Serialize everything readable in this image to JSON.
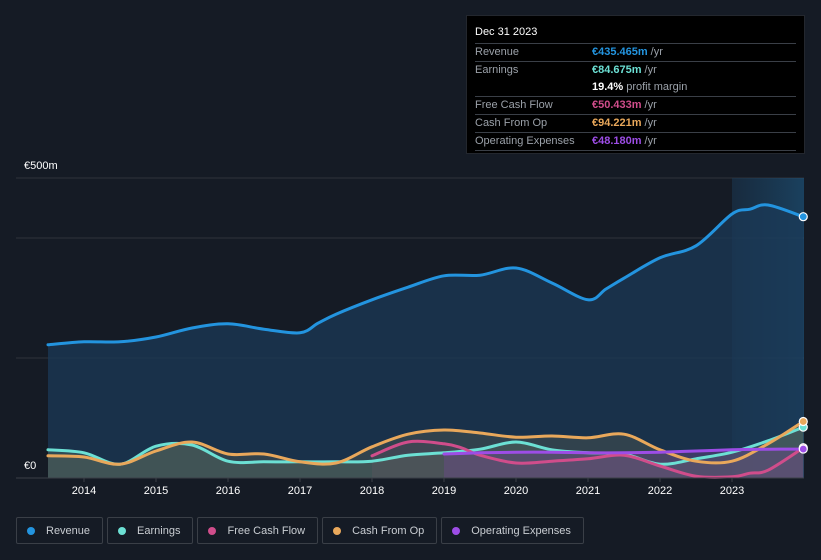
{
  "tooltip": {
    "date": "Dec 31 2023",
    "rows": [
      {
        "label": "Revenue",
        "value": "€435.465m",
        "unit": "/yr",
        "color": "#2394df"
      },
      {
        "label": "Earnings",
        "value": "€84.675m",
        "unit": "/yr",
        "color": "#6ce0d4"
      },
      {
        "label": "",
        "value": "19.4%",
        "unit": "profit margin",
        "color": "#ffffff"
      },
      {
        "label": "Free Cash Flow",
        "value": "€50.433m",
        "unit": "/yr",
        "color": "#d04d8b"
      },
      {
        "label": "Cash From Op",
        "value": "€94.221m",
        "unit": "/yr",
        "color": "#e9a85b"
      },
      {
        "label": "Operating Expenses",
        "value": "€48.180m",
        "unit": "/yr",
        "color": "#9d4de6"
      }
    ]
  },
  "legend": [
    {
      "label": "Revenue",
      "color": "#2394df"
    },
    {
      "label": "Earnings",
      "color": "#6ce0d4"
    },
    {
      "label": "Free Cash Flow",
      "color": "#d04d8b"
    },
    {
      "label": "Cash From Op",
      "color": "#e9a85b"
    },
    {
      "label": "Operating Expenses",
      "color": "#9d4de6"
    }
  ],
  "chart_data": {
    "type": "area",
    "title": "",
    "xlabel": "",
    "ylabel": "",
    "ylim": [
      0,
      500
    ],
    "xlim": [
      2013.5,
      2024.0
    ],
    "y_tick_labels": [
      "€0",
      "€500m"
    ],
    "y_gridlines": [
      200,
      400,
      500
    ],
    "x_tick_labels": [
      "2014",
      "2015",
      "2016",
      "2017",
      "2018",
      "2019",
      "2020",
      "2021",
      "2022",
      "2023"
    ],
    "x_ticks": [
      2014,
      2015,
      2016,
      2017,
      2018,
      2019,
      2020,
      2021,
      2022,
      2023
    ],
    "highlight_from": 2023.0,
    "legend_position": "bottom",
    "units": "€m",
    "series": [
      {
        "name": "Revenue",
        "color": "#2394df",
        "x": [
          2013.5,
          2014.0,
          2014.5,
          2015.0,
          2015.5,
          2016.0,
          2016.5,
          2017.0,
          2017.25,
          2017.5,
          2018.0,
          2018.5,
          2019.0,
          2019.5,
          2020.0,
          2020.5,
          2021.0,
          2021.25,
          2021.5,
          2022.0,
          2022.5,
          2023.0,
          2023.25,
          2023.5,
          2023.99
        ],
        "values": [
          222,
          227,
          227,
          235,
          250,
          257,
          248,
          242,
          258,
          273,
          297,
          318,
          337,
          338,
          350,
          325,
          297,
          315,
          333,
          367,
          387,
          440,
          448,
          455,
          435.5
        ]
      },
      {
        "name": "Earnings",
        "color": "#6ce0d4",
        "x": [
          2013.5,
          2014.0,
          2014.5,
          2015.0,
          2015.5,
          2016.0,
          2016.5,
          2017.0,
          2017.5,
          2018.0,
          2018.5,
          2019.0,
          2019.5,
          2020.0,
          2020.5,
          2021.0,
          2021.5,
          2022.0,
          2022.5,
          2023.0,
          2023.5,
          2023.99
        ],
        "values": [
          47,
          42,
          23,
          53,
          55,
          28,
          27,
          27,
          27,
          28,
          38,
          42,
          48,
          60,
          47,
          42,
          40,
          23,
          32,
          43,
          62,
          84.7
        ]
      },
      {
        "name": "Free Cash Flow",
        "color": "#d04d8b",
        "x": [
          2018.0,
          2018.5,
          2019.0,
          2019.25,
          2019.5,
          2020.0,
          2020.5,
          2021.0,
          2021.5,
          2022.0,
          2022.5,
          2023.0,
          2023.25,
          2023.5,
          2023.99
        ],
        "values": [
          37,
          60,
          57,
          50,
          38,
          25,
          28,
          32,
          38,
          20,
          3,
          2,
          8,
          13,
          50.4
        ]
      },
      {
        "name": "Cash From Op",
        "color": "#e9a85b",
        "x": [
          2013.5,
          2014.0,
          2014.5,
          2015.0,
          2015.5,
          2016.0,
          2016.5,
          2017.0,
          2017.5,
          2018.0,
          2018.5,
          2019.0,
          2019.5,
          2020.0,
          2020.5,
          2021.0,
          2021.5,
          2022.0,
          2022.5,
          2023.0,
          2023.5,
          2023.99
        ],
        "values": [
          37,
          35,
          23,
          45,
          60,
          40,
          40,
          27,
          25,
          52,
          73,
          80,
          75,
          68,
          70,
          67,
          73,
          47,
          28,
          28,
          57,
          94.2
        ]
      },
      {
        "name": "Operating Expenses",
        "color": "#9d4de6",
        "x": [
          2019.0,
          2019.5,
          2020.0,
          2020.5,
          2021.0,
          2021.5,
          2022.0,
          2022.5,
          2023.0,
          2023.5,
          2023.99
        ],
        "values": [
          40,
          42,
          43,
          43,
          42,
          42,
          43,
          45,
          47,
          48,
          48.2
        ]
      }
    ]
  }
}
